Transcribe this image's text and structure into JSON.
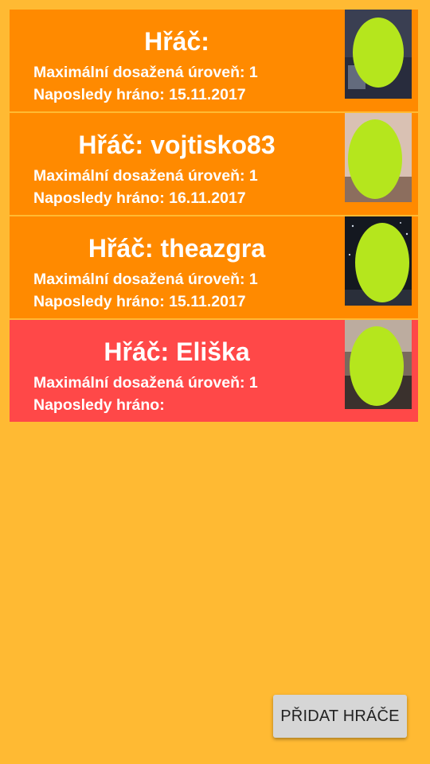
{
  "players": [
    {
      "name_line": "Hřáč:",
      "level_line": "Maximální dosažená úroveň: 1",
      "last_played_line": "Naposledy hráno: 15.11.2017",
      "card_color": "#FF8A00",
      "photo_tone": "#3a3f52",
      "face_color": "#B5E61D"
    },
    {
      "name_line": "Hřáč: vojtisko83",
      "level_line": "Maximální dosažená úroveň: 1",
      "last_played_line": "Naposledy hráno: 16.11.2017",
      "card_color": "#FF8A00",
      "photo_tone": "#d9c1b3",
      "face_color": "#B5E61D"
    },
    {
      "name_line": "Hřáč: theazgra",
      "level_line": "Maximální dosažená úroveň: 1",
      "last_played_line": "Naposledy hráno: 15.11.2017",
      "card_color": "#FF8A00",
      "photo_tone": "#141820",
      "face_color": "#B5E61D"
    },
    {
      "name_line": "Hřáč: Eliška",
      "level_line": "Maximální dosažená úroveň: 1",
      "last_played_line": "Naposledy hráno:",
      "card_color": "#FF4848",
      "photo_tone": "#7a6a5e",
      "face_color": "#B5E61D"
    }
  ],
  "add_player_button": {
    "label": "PŘIDAT HRÁČE"
  },
  "colors": {
    "background": "#FFBA33",
    "button_bg": "#D6D6D6"
  }
}
